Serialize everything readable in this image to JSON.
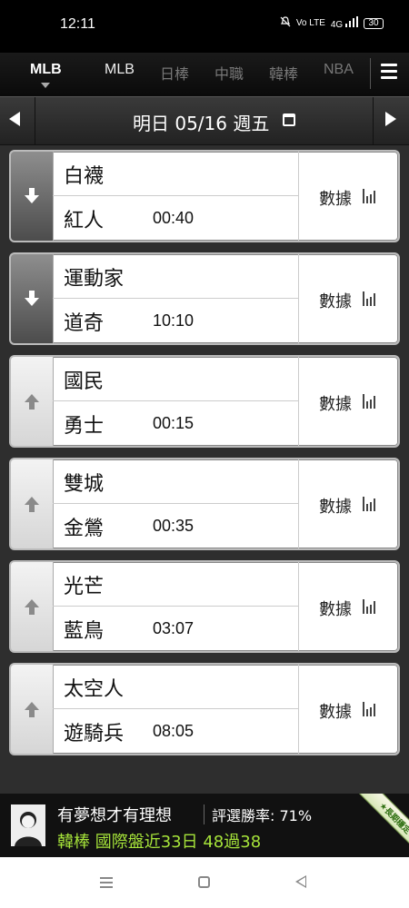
{
  "status_bar": {
    "time": "12:11",
    "icons": [
      "mute-icon",
      "volte-icon",
      "4g-signal-icon",
      "signal-icon"
    ],
    "volte": "Vo LTE",
    "network": "4G",
    "battery": "30"
  },
  "league_tabs": {
    "current": "MLB",
    "items": [
      "MLB",
      "日棒",
      "中職",
      "韓棒",
      "NBA"
    ]
  },
  "date_bar": {
    "label": "明日 05/16 週五"
  },
  "games": [
    {
      "team_top": "白襪",
      "team_bottom": "紅人",
      "time": "00:40",
      "stats_label": "數據",
      "arrow": "down",
      "style": "dark"
    },
    {
      "team_top": "運動家",
      "team_bottom": "道奇",
      "time": "10:10",
      "stats_label": "數據",
      "arrow": "down",
      "style": "dark"
    },
    {
      "team_top": "國民",
      "team_bottom": "勇士",
      "time": "00:15",
      "stats_label": "數據",
      "arrow": "up",
      "style": "light"
    },
    {
      "team_top": "雙城",
      "team_bottom": "金鶯",
      "time": "00:35",
      "stats_label": "數據",
      "arrow": "up",
      "style": "light"
    },
    {
      "team_top": "光芒",
      "team_bottom": "藍鳥",
      "time": "03:07",
      "stats_label": "數據",
      "arrow": "up",
      "style": "light"
    },
    {
      "team_top": "太空人",
      "team_bottom": "遊騎兵",
      "time": "08:05",
      "stats_label": "數據",
      "arrow": "up",
      "style": "light"
    }
  ],
  "banner": {
    "title": "有夢想才有理想",
    "win_rate": "評選勝率: 71%",
    "record": "韓棒 國際盤近33日 48過38",
    "ribbon": "★長期穩定★",
    "record_color": "#a6e43a"
  }
}
